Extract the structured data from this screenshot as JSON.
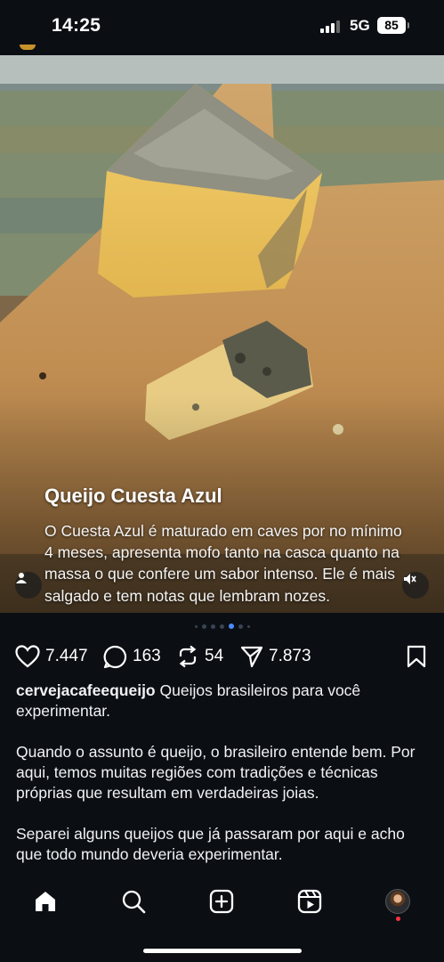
{
  "status_bar": {
    "time": "14:25",
    "network": "5G",
    "battery": "85"
  },
  "post": {
    "image_title": "Queijo Cuesta Azul",
    "image_text": "O Cuesta Azul é maturado em caves por no mínimo 4 meses, apresenta mofo tanto na casca quanto na massa o que confere um sabor intenso. Ele é mais salgado e tem notas que lembram nozes.",
    "carousel": {
      "total_dots": 7,
      "active_index": 4
    },
    "actions": {
      "likes": "7.447",
      "comments": "163",
      "reposts": "54",
      "shares": "7.873"
    },
    "username": "cervejacafeequeijo",
    "caption_lines": [
      "Queijos brasileiros para você experimentar.",
      "Quando o assunto é queijo, o brasileiro entende bem. Por aqui, temos muitas regiões com tradições e técnicas próprias que resultam em verdadeiras joias.",
      "Separei alguns queijos que já passaram por aqui e acho que todo mundo deveria experimentar."
    ]
  },
  "nav": {
    "items": [
      "home-icon",
      "search-icon",
      "create-icon",
      "reels-icon",
      "profile-avatar"
    ]
  },
  "colors": {
    "background": "#0b0f14",
    "active_dot": "#4a8cff",
    "notification_dot": "#ff3040"
  }
}
